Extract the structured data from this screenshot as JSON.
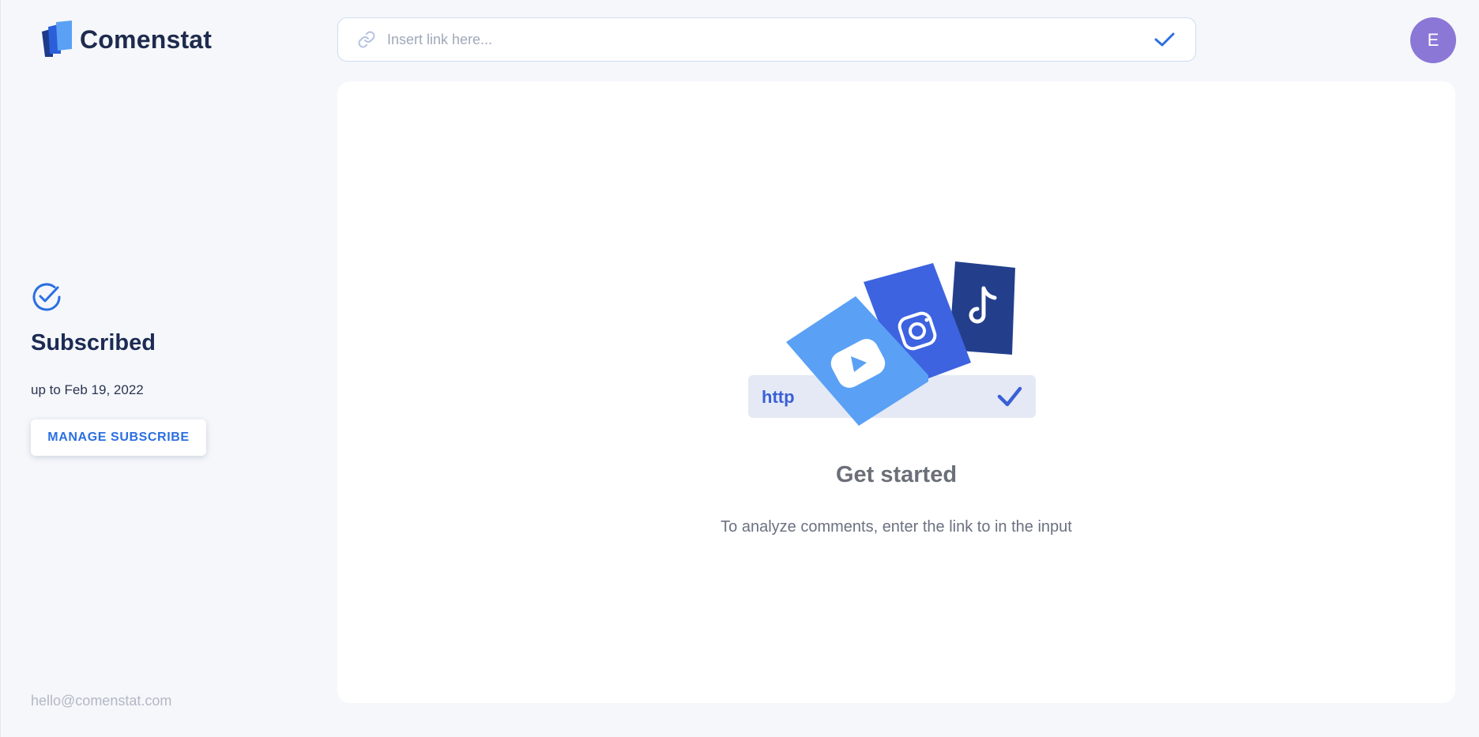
{
  "app": {
    "name": "Comenstat"
  },
  "link_bar": {
    "placeholder": "Insert link here...",
    "value": ""
  },
  "user": {
    "avatar_initial": "E"
  },
  "subscription": {
    "status": "Subscribed",
    "until": "up to Feb 19, 2022",
    "manage_label": "MANAGE SUBSCRIBE"
  },
  "contact": {
    "email": "hello@comenstat.com"
  },
  "main": {
    "illustration_label": "http",
    "title": "Get started",
    "subtitle": "To analyze comments, enter the link to in the input"
  },
  "icons": {
    "logo": "logo-icon",
    "link": "link-icon",
    "submit": "checkmark-icon",
    "subscribed": "check-circle-icon",
    "youtube": "youtube-icon",
    "instagram": "instagram-icon",
    "tiktok": "tiktok-icon"
  },
  "colors": {
    "accent": "#2b6fe0",
    "avatar": "#8a77d6",
    "background": "#f5f7fb",
    "title_dark": "#1c2b54",
    "youtube_card": "#5aa0f5",
    "instagram_card": "#3d63e0",
    "tiktok_card": "#233f8c"
  }
}
